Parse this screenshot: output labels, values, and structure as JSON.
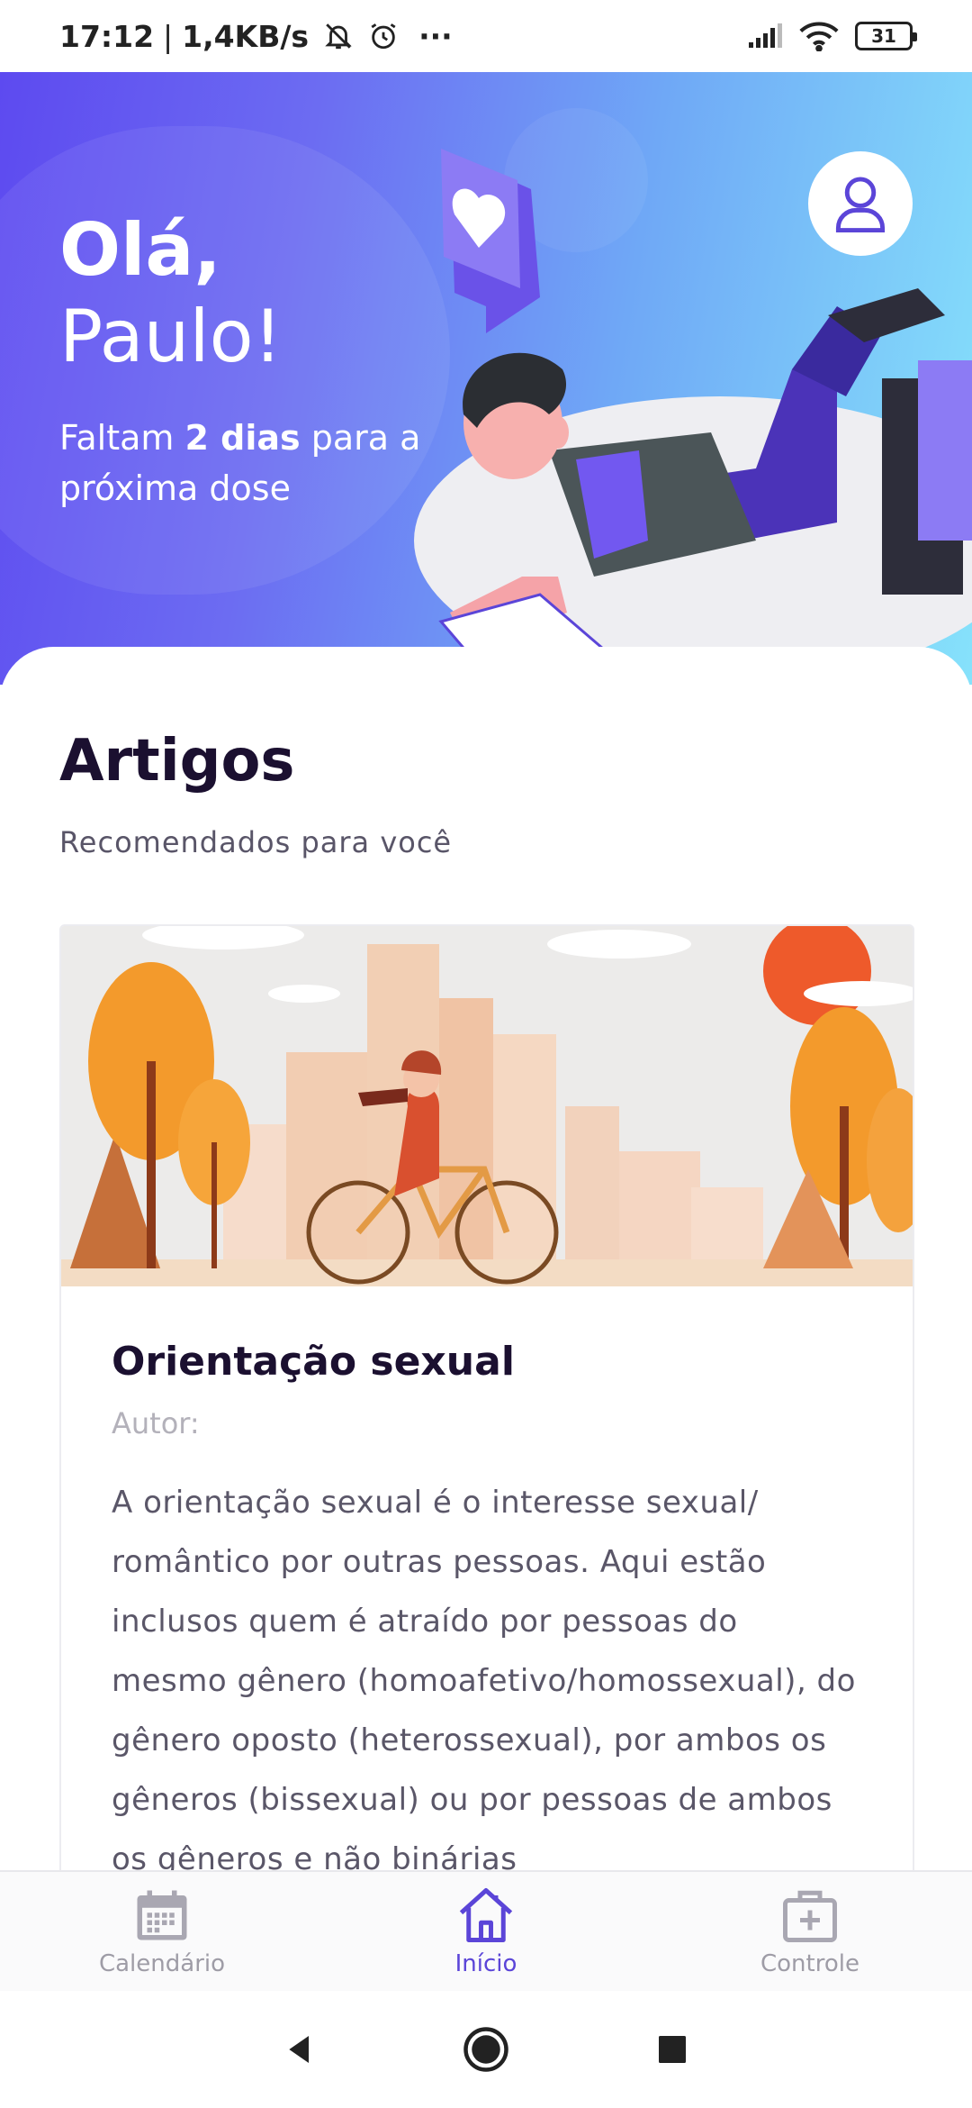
{
  "status_bar": {
    "time": "17:12",
    "separator": "|",
    "network_speed": "1,4KB/s",
    "more": "···",
    "battery": "31"
  },
  "hero": {
    "greeting": "Olá,",
    "name": "Paulo!",
    "dose_prefix": "Faltam ",
    "dose_days": "2 dias",
    "dose_suffix": " para a próxima dose"
  },
  "articles_section": {
    "title": "Artigos",
    "subtitle": "Recomendados para você"
  },
  "article": {
    "title": "Orientação sexual",
    "author_label": "Autor:",
    "body": "A orientação sexual é o interesse sexual/ romântico por outras pessoas. Aqui estão inclusos quem é atraído por pessoas do mesmo gênero (homoafetivo/homossexual), do gênero oposto (heterossexual), por ambos os gêneros (bissexual) ou por pessoas de ambos os gêneros e não binárias"
  },
  "bottom_nav": {
    "items": [
      {
        "label": "Calendário",
        "icon": "calendar-icon",
        "active": false
      },
      {
        "label": "Início",
        "icon": "home-icon",
        "active": true
      },
      {
        "label": "Controle",
        "icon": "medical-kit-icon",
        "active": false
      }
    ]
  },
  "colors": {
    "accent": "#5b45d8",
    "hero_start": "#5d4af0",
    "hero_end": "#86e2fb",
    "title_text": "#1b1030"
  }
}
